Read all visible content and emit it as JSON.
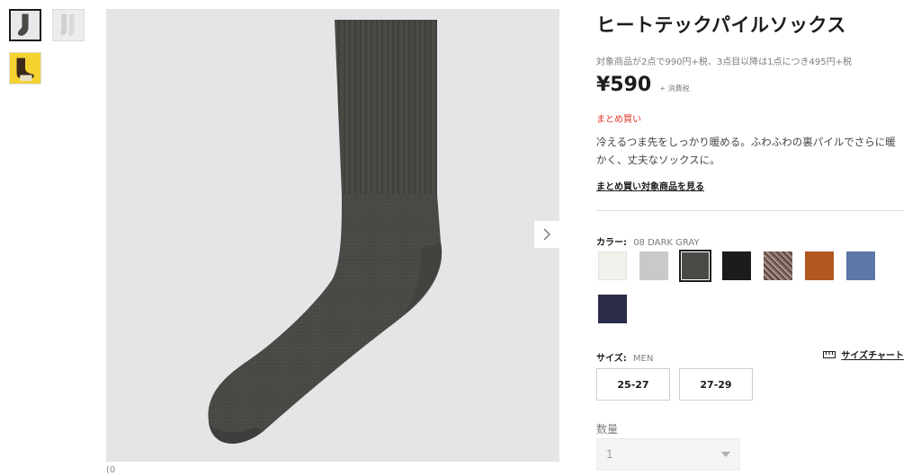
{
  "product": {
    "title": "ヒートテックパイルソックス",
    "promo": "対象商品が2点で990円+税、3点目以降は1点につき495円+税",
    "price": "¥590",
    "tax_note": "+ 消費税",
    "badge": "まとめ買い",
    "description": "冷えるつま先をしっかり暖める。ふわふわの裏パイルでさらに暖かく、丈夫なソックスに。",
    "bundle_link": "まとめ買い対象商品を見る"
  },
  "gallery": {
    "thumbnails": [
      "dark-gray-sock",
      "light-gray-sock-pair",
      "sock-worn-on-yellow"
    ],
    "next_icon": "chevron-right-icon",
    "below_text": "(0"
  },
  "color": {
    "label": "カラー:",
    "selected": "08 DARK GRAY",
    "swatches": [
      {
        "name": "off-white",
        "color": "#f3f1ec"
      },
      {
        "name": "light-gray",
        "color": "#c9c9c9"
      },
      {
        "name": "dark-gray",
        "color": "#4a4945"
      },
      {
        "name": "black",
        "color": "#1c1c1c"
      },
      {
        "name": "brown-mix",
        "color": "#8b7068"
      },
      {
        "name": "orange-brown",
        "color": "#b2571f"
      },
      {
        "name": "blue",
        "color": "#5f77a8"
      },
      {
        "name": "navy",
        "color": "#2a2c4a"
      }
    ],
    "selected_index": 2
  },
  "size": {
    "label": "サイズ:",
    "category": "MEN",
    "chart_label": "サイズチャート",
    "chart_icon": "ruler-icon",
    "options": [
      "25-27",
      "27-29"
    ]
  },
  "quantity": {
    "label": "数量",
    "value": "1",
    "caret_icon": "caret-down-icon"
  },
  "colors": {
    "accent_red": "#e2342a",
    "text": "#1b1b1b",
    "muted": "#7d7d7d"
  }
}
